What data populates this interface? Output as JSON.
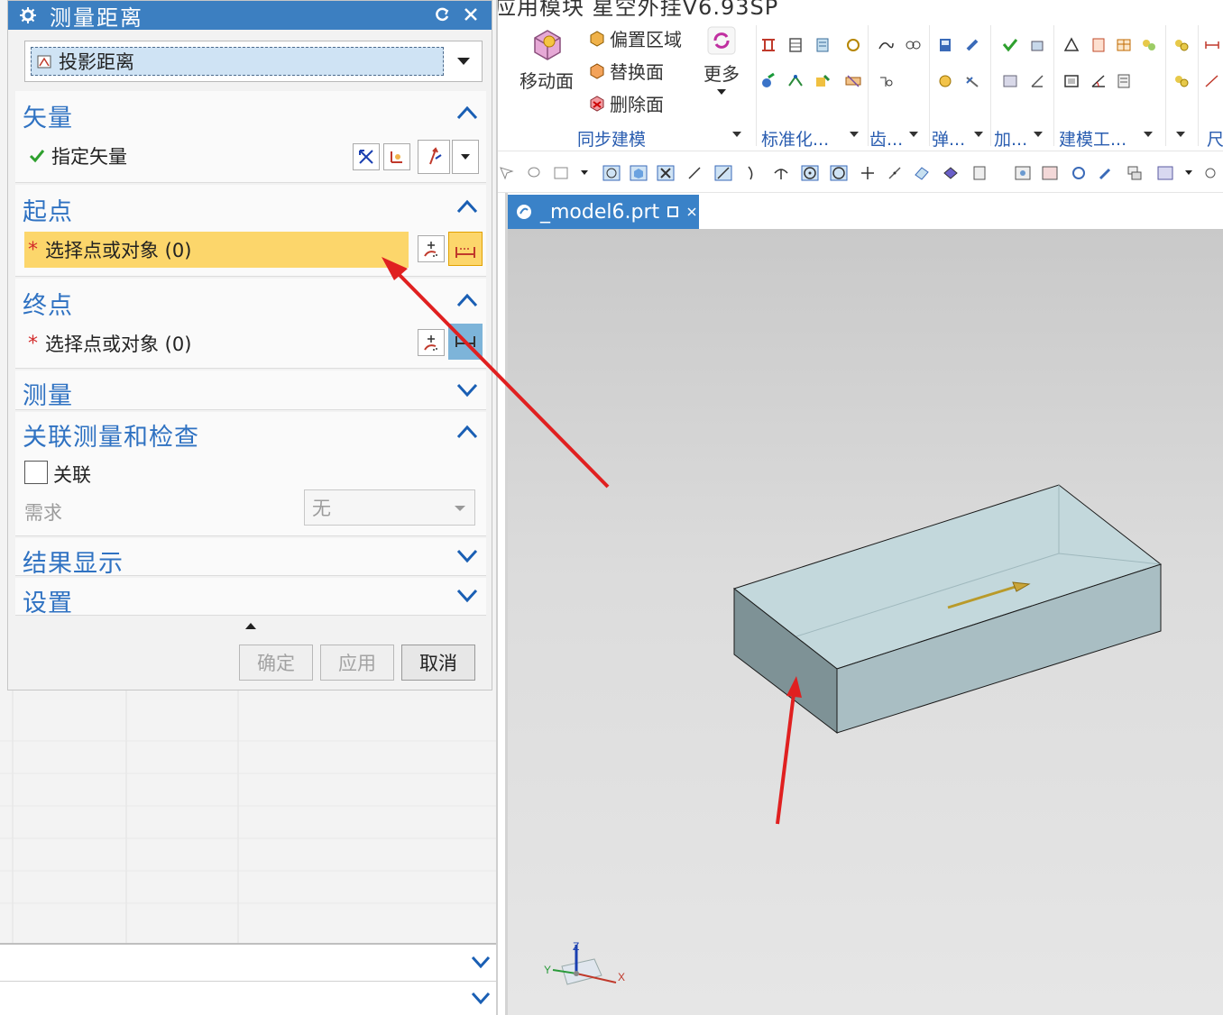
{
  "app": {
    "title": "应用模块    星空外挂V6.93SP"
  },
  "dialog": {
    "title": "测量距离",
    "type_value": "投影距离",
    "sections": {
      "vector": {
        "title": "矢量",
        "row_label": "指定矢量"
      },
      "start": {
        "title": "起点",
        "row_label": "选择点或对象 (0)"
      },
      "end": {
        "title": "终点",
        "row_label": "选择点或对象 (0)"
      },
      "measure": {
        "title": "测量"
      },
      "assoc": {
        "title": "关联测量和检查",
        "checkbox_label": "关联",
        "require_label": "需求",
        "require_value": "无"
      },
      "results": {
        "title": "结果显示"
      },
      "settings": {
        "title": "设置"
      }
    },
    "buttons": {
      "ok": "确定",
      "apply": "应用",
      "cancel": "取消"
    }
  },
  "ribbon": {
    "move_face": "移动面",
    "offset_region": "偏置区域",
    "replace_face": "替换面",
    "delete_face": "删除面",
    "more": "更多",
    "groups": {
      "sync_modeling": "同步建模",
      "standardize": "标准化...",
      "gear": "齿...",
      "spring": "弹...",
      "add": "加...",
      "modeling_tools": "建模工...",
      "dim": "尺"
    }
  },
  "document": {
    "tab_label": "_model6.prt"
  },
  "triad": {
    "x": "X",
    "y": "Y",
    "z": "Z"
  },
  "colors": {
    "accent": "#3c7fc1",
    "section_title": "#2f72c2",
    "highlight": "#fcd66b",
    "annotation_arrow": "#e02020",
    "box_fill": "#b9cfd6"
  }
}
